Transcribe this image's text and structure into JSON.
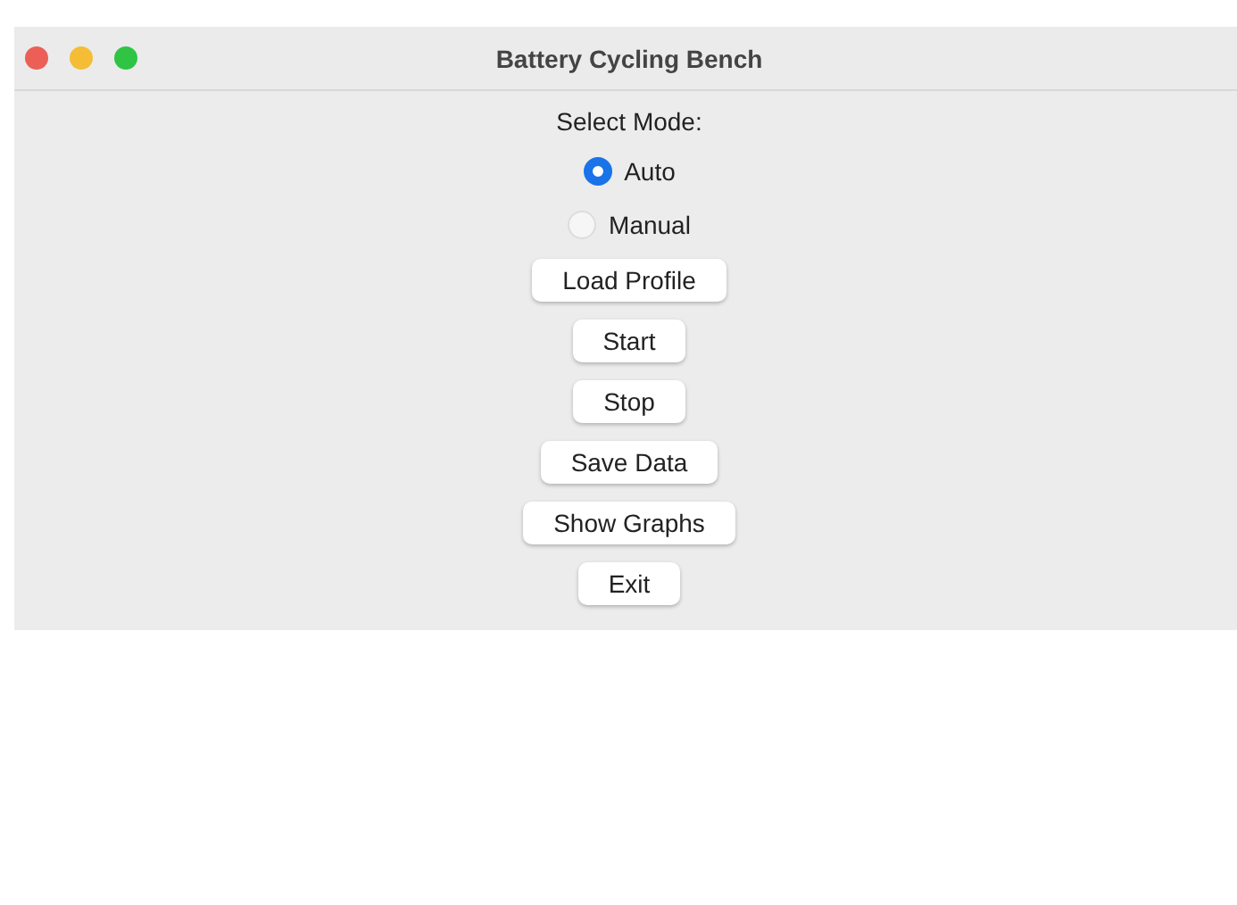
{
  "window": {
    "title": "Battery Cycling Bench"
  },
  "mode_label": "Select Mode:",
  "modes": [
    {
      "label": "Auto",
      "selected": true
    },
    {
      "label": "Manual",
      "selected": false
    }
  ],
  "buttons": [
    "Load Profile",
    "Start",
    "Stop",
    "Save Data",
    "Show Graphs",
    "Exit"
  ]
}
